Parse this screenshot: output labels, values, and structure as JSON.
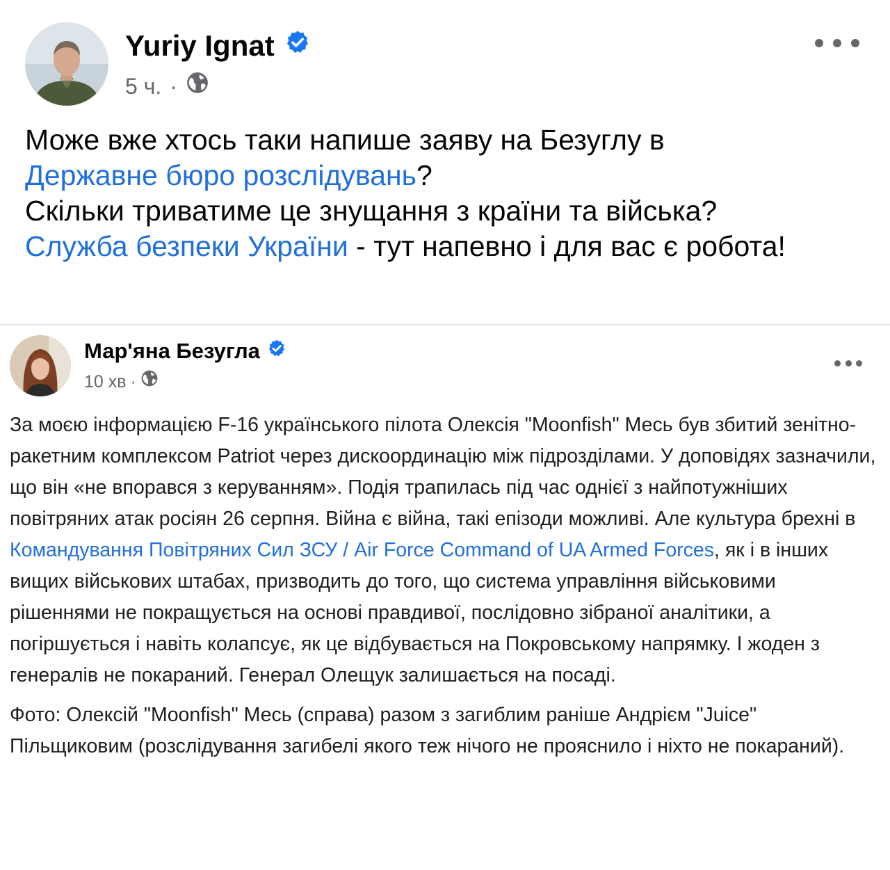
{
  "post": {
    "author": "Yuriy Ignat",
    "verified": true,
    "time": "5 ч.",
    "separator": "·",
    "audience_icon": "globe-icon",
    "text": {
      "line1": "Може вже хтось таки напише заяву на Безуглу в",
      "link1": "Державне бюро розслідувань",
      "after_link1": "?",
      "line3": "Скільки триватиме це знущання з країни та війська?",
      "link2": "Служба безпеки України",
      "after_link2": " - тут напевно і для вас є робота!"
    }
  },
  "shared_post": {
    "author": "Мар'яна Безугла",
    "verified": true,
    "time": "10 хв",
    "separator": "·",
    "audience_icon": "globe-icon",
    "paragraph1": {
      "before_link": "За моєю інформацією F-16 українського пілота Олексія \"Moonfish\" Месь був збитий зенітно-ракетним комплексом Patriot через дискоординацію між підрозділами. У доповідях зазначили, що він «не впорався з керуванням». Подія трапилась під час однієї з найпотужніших повітряних атак росіян 26 серпня. Війна є війна, такі епізоди можливі. Але культура брехні в ",
      "link": "Командування Повітряних Сил ЗСУ / Air Force Command of UA Armed Forces",
      "after_link": ", як і в інших вищих військових штабах, призводить до того, що система управління військовими рішеннями не покращується на основі правдивої, послідовно зібраної аналітики, а погіршується і навіть колапсує, як це відбувається на Покровському напрямку. І жоден з генералів не покараний. Генерал Олещук залишається на посаді."
    },
    "paragraph2": "Фото: Олексій \"Moonfish\" Месь (справа) разом з загиблим раніше Андрієм \"Juice\" Пільщиковим (розслідування загибелі якого теж нічого не прояснило і ніхто не покараний)."
  },
  "icons": {
    "verified_badge": "verified-badge-icon",
    "more": "more-options-icon",
    "audience": "globe-icon"
  },
  "colors": {
    "link": "#216fdb",
    "verified": "#1877f2",
    "muted": "#65676b",
    "divider": "#e4e6eb"
  }
}
